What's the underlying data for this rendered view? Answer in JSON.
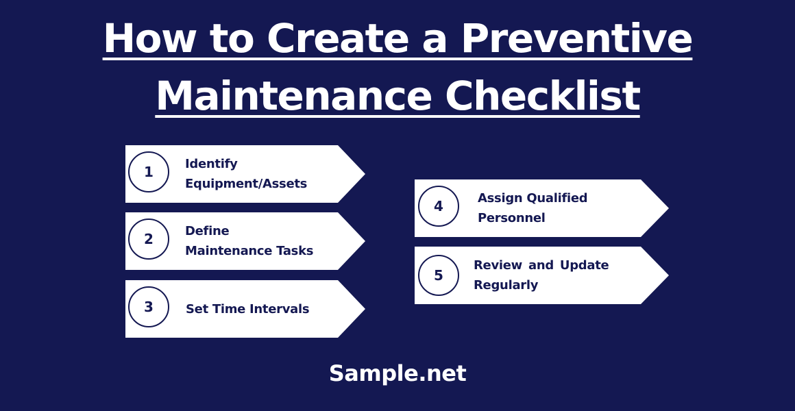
{
  "title": {
    "line1": "How to Create a Preventive",
    "line2": "Maintenance Checklist"
  },
  "steps": [
    {
      "number": "1",
      "line1": "Identify",
      "line2": "Equipment/Assets"
    },
    {
      "number": "2",
      "line1": "Define",
      "line2": "Maintenance Tasks"
    },
    {
      "number": "3",
      "line1": "Set Time Intervals",
      "line2": ""
    },
    {
      "number": "4",
      "line1": "Assign Qualified",
      "line2": "Personnel"
    },
    {
      "number": "5",
      "line1": "Review and Update",
      "line2": "Regularly"
    }
  ],
  "footer": {
    "brand": "Sample.net"
  },
  "colors": {
    "background": "#141852",
    "card": "#ffffff",
    "text": "#141852"
  }
}
